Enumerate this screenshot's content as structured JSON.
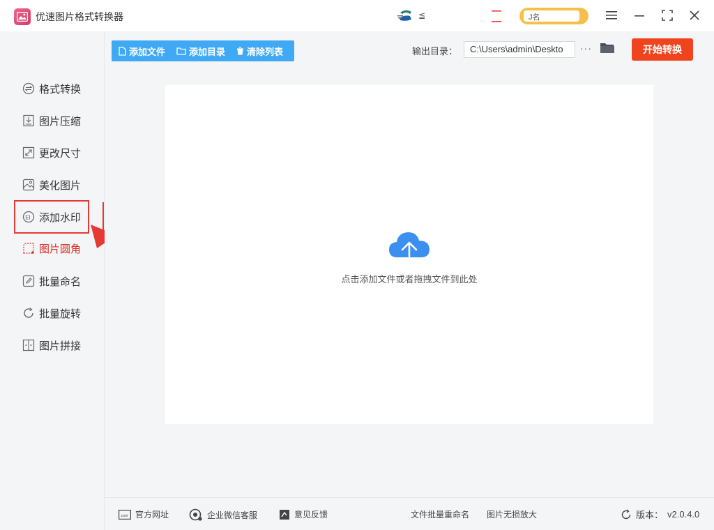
{
  "app": {
    "title": "优速图片格式转换器",
    "brand_text": "≦",
    "user_text": "J名"
  },
  "colors": {
    "accent_blue": "#3fa9f5",
    "start_orange": "#f0441f",
    "active_red": "#e53935",
    "cloud_blue": "#3b8fef"
  },
  "sidebar": {
    "items": [
      {
        "label": "格式转换",
        "icon": "format-convert-icon"
      },
      {
        "label": "图片压缩",
        "icon": "compress-icon"
      },
      {
        "label": "更改尺寸",
        "icon": "resize-icon"
      },
      {
        "label": "美化图片",
        "icon": "beautify-icon"
      },
      {
        "label": "添加水印",
        "icon": "watermark-icon"
      },
      {
        "label": "图片圆角",
        "icon": "round-corner-icon"
      },
      {
        "label": "批量命名",
        "icon": "rename-icon"
      },
      {
        "label": "批量旋转",
        "icon": "rotate-icon"
      },
      {
        "label": "图片拼接",
        "icon": "stitch-icon"
      }
    ],
    "active_index": 5
  },
  "toolbar": {
    "add_file": "添加文件",
    "add_folder": "添加目录",
    "clear_list": "清除列表"
  },
  "output": {
    "label": "输出目录：",
    "path": "C:\\Users\\admin\\Deskto",
    "more": "···"
  },
  "start_button": "开始转换",
  "dropzone": {
    "hint": "点击添加文件或者拖拽文件到此处"
  },
  "footer": {
    "website": "官方网址",
    "wechat": "企业微信客服",
    "feedback": "意见反馈",
    "batch_rename": "文件批量重命名",
    "lossless_zoom": "图片无损放大",
    "version_label": "版本：",
    "version": "v2.0.4.0"
  }
}
